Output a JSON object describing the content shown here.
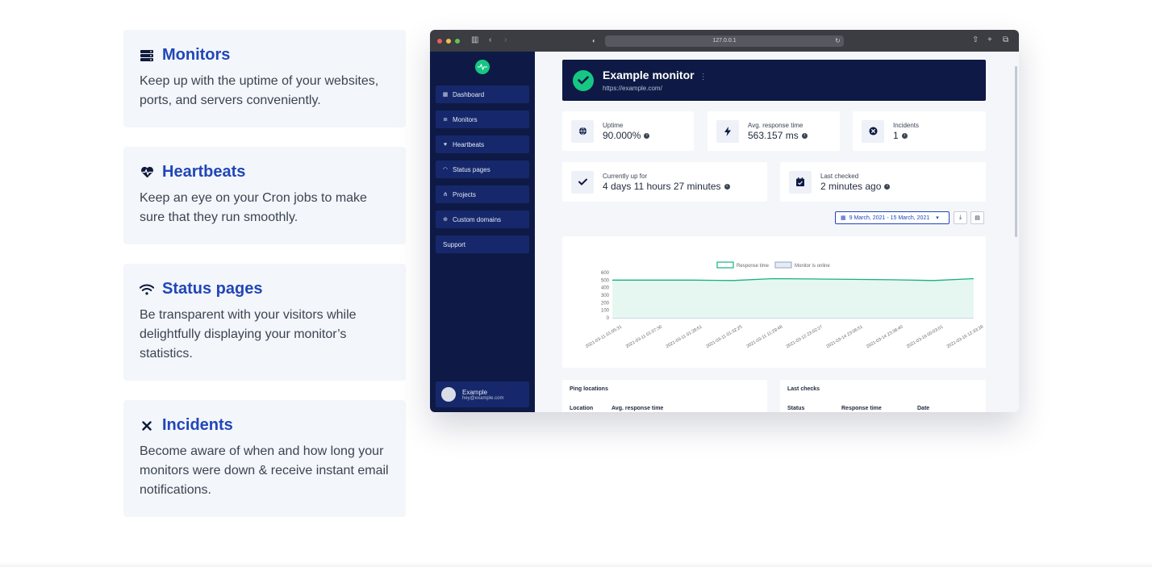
{
  "features": [
    {
      "icon": "server-stack-icon",
      "title": "Monitors",
      "desc": "Keep up with the uptime of your websites, ports, and servers conveniently."
    },
    {
      "icon": "heart-pulse-icon",
      "title": "Heartbeats",
      "desc": "Keep an eye on your Cron jobs to make sure that they run smoothly."
    },
    {
      "icon": "wifi-icon",
      "title": "Status pages",
      "desc": "Be transparent with your visitors while delightfully displaying your monitor’s statistics."
    },
    {
      "icon": "close-icon",
      "title": "Incidents",
      "desc": "Become aware of when and how long your monitors were down & receive instant email notifications."
    }
  ],
  "browser": {
    "url": "127.0.0.1",
    "sidebar": {
      "items": [
        {
          "icon": "grid-icon",
          "label": "Dashboard"
        },
        {
          "icon": "list-icon",
          "label": "Monitors"
        },
        {
          "icon": "heart-pulse-icon",
          "label": "Heartbeats"
        },
        {
          "icon": "wifi-icon",
          "label": "Status pages"
        },
        {
          "icon": "sitemap-icon",
          "label": "Projects"
        },
        {
          "icon": "globe-icon",
          "label": "Custom domains"
        },
        {
          "icon": "",
          "label": "Support"
        }
      ],
      "user": {
        "name": "Example",
        "email": "hey@example.com"
      }
    },
    "monitor": {
      "name": "Example monitor",
      "url": "https://example.com/"
    },
    "stats": {
      "uptime": {
        "label": "Uptime",
        "value": "90.000%"
      },
      "avg_response": {
        "label": "Avg. response time",
        "value": "563.157 ms"
      },
      "incidents": {
        "label": "Incidents",
        "value": "1"
      },
      "currently_up": {
        "label": "Currently up for",
        "value": "4 days 11 hours 27 minutes"
      },
      "last_checked": {
        "label": "Last checked",
        "value": "2 minutes ago"
      }
    },
    "date_range": "9 March, 2021 - 15 March, 2021",
    "ping_locations": {
      "title": "Ping locations",
      "columns": [
        "Location",
        "Avg. response time"
      ]
    },
    "last_checks": {
      "title": "Last checks",
      "columns": [
        "Status",
        "Response time",
        "Date"
      ]
    }
  },
  "chart_data": {
    "type": "area",
    "legend": [
      "Response time",
      "Monitor is online"
    ],
    "y_ticks": [
      "600",
      "500",
      "400",
      "300",
      "200",
      "100",
      "0"
    ],
    "ylim": [
      0,
      600
    ],
    "x": [
      "2021-03-11 01:05:31",
      "2021-03-11 01:07:30",
      "2021-03-11 01:28:51",
      "2021-03-11 01:32:25",
      "2021-03-11 11:29:48",
      "2021-03-12 23:02:27",
      "2021-03-14 23:06:51",
      "2021-03-14 23:36:40",
      "2021-03-16 00:03:01",
      "2021-03-16 12:33:28"
    ],
    "series": [
      {
        "name": "Response time",
        "values": [
          500,
          500,
          500,
          495,
          520,
          515,
          510,
          505,
          495,
          520
        ]
      }
    ],
    "colors": {
      "line": "#16b37a",
      "fill": "#e6f7f1"
    }
  }
}
